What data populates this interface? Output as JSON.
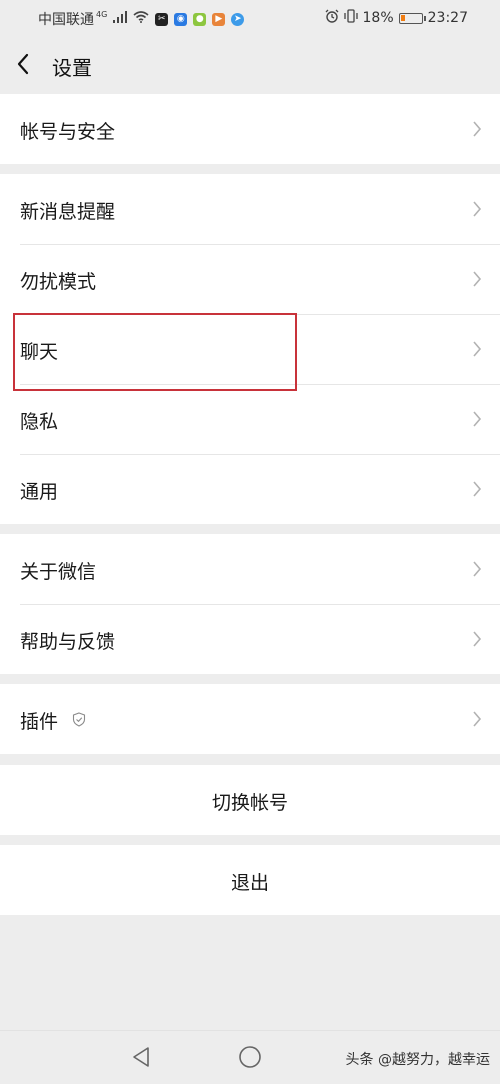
{
  "status_bar": {
    "carrier": "中国联通",
    "network": "4G",
    "battery": "18%",
    "time": "23:27"
  },
  "header": {
    "title": "设置"
  },
  "groups": [
    {
      "items": [
        {
          "label": "帐号与安全"
        }
      ]
    },
    {
      "items": [
        {
          "label": "新消息提醒"
        },
        {
          "label": "勿扰模式"
        },
        {
          "label": "聊天"
        },
        {
          "label": "隐私"
        },
        {
          "label": "通用"
        }
      ]
    },
    {
      "items": [
        {
          "label": "关于微信"
        },
        {
          "label": "帮助与反馈"
        }
      ]
    },
    {
      "items": [
        {
          "label": "插件"
        }
      ]
    }
  ],
  "actions": {
    "switch_account": "切换帐号",
    "logout": "退出"
  },
  "watermark": "头条 @越努力，越幸运",
  "colors": {
    "background": "#ededed",
    "highlight_border": "#c8323a",
    "battery_low": "#f07d12"
  }
}
